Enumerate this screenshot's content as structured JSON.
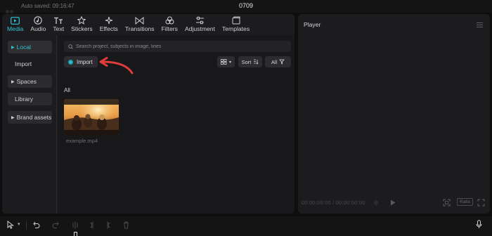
{
  "window": {
    "autosave": "Auto saved: 09:16:47",
    "project_title": "0709"
  },
  "toolbar": {
    "tabs": [
      {
        "label": "Media",
        "icon": "media-icon",
        "active": true
      },
      {
        "label": "Audio",
        "icon": "audio-icon",
        "active": false
      },
      {
        "label": "Text",
        "icon": "text-icon",
        "active": false
      },
      {
        "label": "Stickers",
        "icon": "stickers-icon",
        "active": false
      },
      {
        "label": "Effects",
        "icon": "effects-icon",
        "active": false
      },
      {
        "label": "Transitions",
        "icon": "transitions-icon",
        "active": false
      },
      {
        "label": "Filters",
        "icon": "filters-icon",
        "active": false
      },
      {
        "label": "Adjustment",
        "icon": "adjustment-icon",
        "active": false
      },
      {
        "label": "Templates",
        "icon": "templates-icon",
        "active": false
      }
    ]
  },
  "sidebar": {
    "items": [
      {
        "label": "Local",
        "caret": true,
        "active": true
      },
      {
        "label": "Import",
        "caret": false,
        "active": false
      },
      {
        "label": "Spaces",
        "caret": true,
        "active": false
      },
      {
        "label": "Library",
        "caret": false,
        "active": false
      },
      {
        "label": "Brand assets",
        "caret": true,
        "active": false
      }
    ]
  },
  "content": {
    "search_placeholder": "Search project, subjects in image, lines",
    "import_label": "Import",
    "sort_label": "Sort",
    "filter_label": "All",
    "section_label": "All",
    "media_items": [
      {
        "name": "example.mp4"
      }
    ]
  },
  "player": {
    "title": "Player",
    "timecode": "00:00:00:00 / 00:00:00:00",
    "ratio_label": "Ratio"
  },
  "colors": {
    "accent": "#2ec4d6",
    "arrow": "#e23b3b",
    "panel": "#1c1c1e",
    "background": "#0e0e0f"
  }
}
